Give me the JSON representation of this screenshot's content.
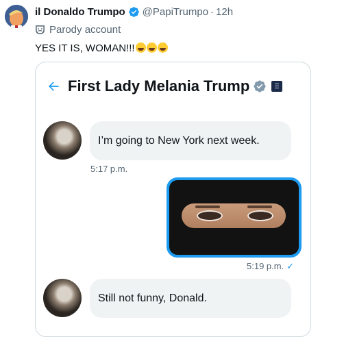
{
  "tweet": {
    "author_name": "il Donaldo Trumpo",
    "handle": "@PapiTrumpo",
    "separator": "·",
    "time": "12h",
    "parody_label": "Parody account",
    "text": "YES IT IS, WOMAN!!!",
    "emojis": [
      "rolling-on-floor-laughing",
      "rolling-on-floor-laughing",
      "rolling-on-floor-laughing"
    ]
  },
  "dm": {
    "title": "First Lady Melania Trump",
    "messages": [
      {
        "from": "other",
        "text": "I’m going to New York next week.",
        "time": "5:17 p.m."
      },
      {
        "from": "self",
        "type": "image",
        "image_desc": "niqab-eyes",
        "time": "5:19 p.m.",
        "read_mark": "✓"
      },
      {
        "from": "other",
        "text": "Still not funny, Donald."
      }
    ]
  },
  "colors": {
    "accent": "#1d9bf0",
    "text": "#0f1419",
    "secondary": "#536471",
    "bubble": "#eff3f4",
    "border": "#cfd9de"
  }
}
